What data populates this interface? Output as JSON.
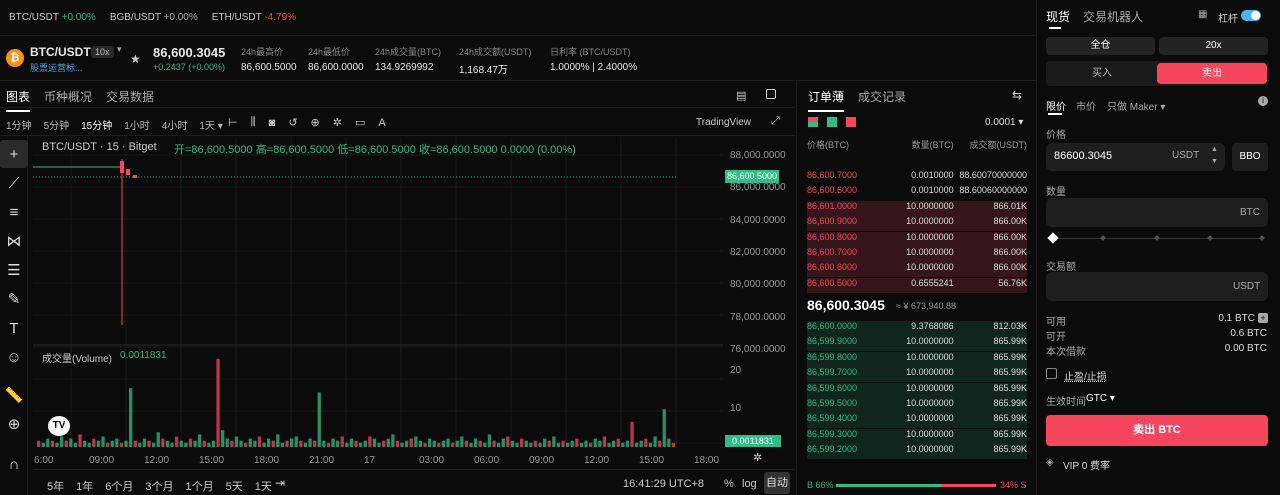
{
  "ticker": [
    {
      "sym": "BTC/USDT",
      "chg": "+0.00%",
      "color": "#2ebd85"
    },
    {
      "sym": "BGB/USDT",
      "chg": "+0.00%",
      "color": "#aaaaaa"
    },
    {
      "sym": "ETH/USDT",
      "chg": "-4.79%",
      "color": "#f6465d"
    }
  ],
  "header": {
    "pair": "BTC/USDT",
    "leverage": "10x",
    "sub": "股票运营标...",
    "price": "86,600.3045",
    "change": "+0.2437 (+0.00%)",
    "stats": [
      {
        "l": "24h最高价",
        "v": "86,600.5000"
      },
      {
        "l": "24h最低价",
        "v": "86,600.0000"
      },
      {
        "l": "24h成交量(BTC)",
        "v": "134.9269992"
      },
      {
        "l": "24h成交额(USDT)",
        "v": "1,168.47万"
      },
      {
        "l": "日利率 (BTC/USDT)",
        "v": "1.0000% | 2.4000%"
      }
    ]
  },
  "chart_tabs": [
    "图表",
    "币种概况",
    "交易数据"
  ],
  "intervals": [
    "1分钟",
    "5分钟",
    "15分钟",
    "1小时",
    "4小时",
    "1天"
  ],
  "tradingview": "TradingView",
  "legend": {
    "title": "BTC/USDT · 15 · Bitget",
    "ohlc": "开=86,600.5000 高=86,600.5000 低=86,600.5000 收=86,600.5000 0.0000 (0.00%)"
  },
  "price_axis": [
    "88,000.0000",
    "86,000.0000",
    "84,000.0000",
    "82,000.0000",
    "80,000.0000",
    "78,000.0000",
    "76,000.0000"
  ],
  "price_tag": "86,600.5000",
  "volume": {
    "label": "成交量(Volume)",
    "value": "0.0011831",
    "axis": [
      "20",
      "10"
    ],
    "tag": "0.0011831"
  },
  "time_axis": [
    "6:00",
    "09:00",
    "12:00",
    "15:00",
    "18:00",
    "21:00",
    "17",
    "03:00",
    "06:00",
    "09:00",
    "12:00",
    "15:00",
    "18:00"
  ],
  "ranges": [
    "5年",
    "1年",
    "6个月",
    "3个月",
    "1个月",
    "5天",
    "1天"
  ],
  "clock": "16:41:29 UTC+8",
  "bottom": [
    "%",
    "log",
    "自动"
  ],
  "orderbook": {
    "tabs": [
      "订单薄",
      "成交记录"
    ],
    "precision": "0.0001",
    "headers": [
      "价格(BTC)",
      "数量(BTC)",
      "成交额(USDT)"
    ],
    "asks": [
      [
        "86,600.7000",
        "0.0010000",
        "88.60070000000"
      ],
      [
        "86,600.6000",
        "0.0010000",
        "88.60060000000"
      ],
      [
        "86,601.0000",
        "10.0000000",
        "866.01K"
      ],
      [
        "86,600.9000",
        "10.0000000",
        "866.00K"
      ],
      [
        "86,600.8000",
        "10.0000000",
        "866.00K"
      ],
      [
        "86,600.7000",
        "10.0000000",
        "866.00K"
      ],
      [
        "86,600.6000",
        "10.0000000",
        "866.00K"
      ],
      [
        "86,600.5000",
        "0.6555241",
        "56.76K"
      ]
    ],
    "mid": "86,600.3045",
    "mid_sub": "≈ ¥ 673,940.88",
    "bids": [
      [
        "86,600.0000",
        "9.3768086",
        "812.03K"
      ],
      [
        "86,599.9000",
        "10.0000000",
        "865.99K"
      ],
      [
        "86,599.8000",
        "10.0000000",
        "865.99K"
      ],
      [
        "86,599.7000",
        "10.0000000",
        "865.99K"
      ],
      [
        "86,599.6000",
        "10.0000000",
        "865.99K"
      ],
      [
        "86,599.5000",
        "10.0000000",
        "865.99K"
      ],
      [
        "86,599.4000",
        "10.0000000",
        "865.99K"
      ],
      [
        "86,599.3000",
        "10.0000000",
        "865.99K"
      ],
      [
        "86,599.2000",
        "10.0000000",
        "865.99K"
      ]
    ],
    "ratio_b": "B 66%",
    "ratio_s": "34% S",
    "buy_ratio": 0.66
  },
  "panel": {
    "tabs": [
      "现货",
      "交易机器人"
    ],
    "leverage_label": "杠杆",
    "margin": "全仓",
    "lev": "20x",
    "buy": "买入",
    "sell": "卖出",
    "order_types": [
      "限价",
      "市价",
      "只做 Maker"
    ],
    "price_label": "价格",
    "price_value": "86600.3045",
    "unit": "USDT",
    "bbo": "BBO",
    "qty_label": "数量",
    "qty_unit": "BTC",
    "amount_label": "交易额",
    "amount_unit": "USDT",
    "info": [
      [
        "可用",
        "0.1 BTC"
      ],
      [
        "可开",
        "0.6 BTC"
      ],
      [
        "本次借款",
        "0.00 BTC"
      ]
    ],
    "tpsl": "止盈/止损",
    "tif_label": "生效时间",
    "tif": "GTC",
    "submit": "卖出 BTC",
    "vip": "VIP 0 费率"
  },
  "colors": {
    "green": "#2ebd85",
    "red": "#f6465d"
  }
}
